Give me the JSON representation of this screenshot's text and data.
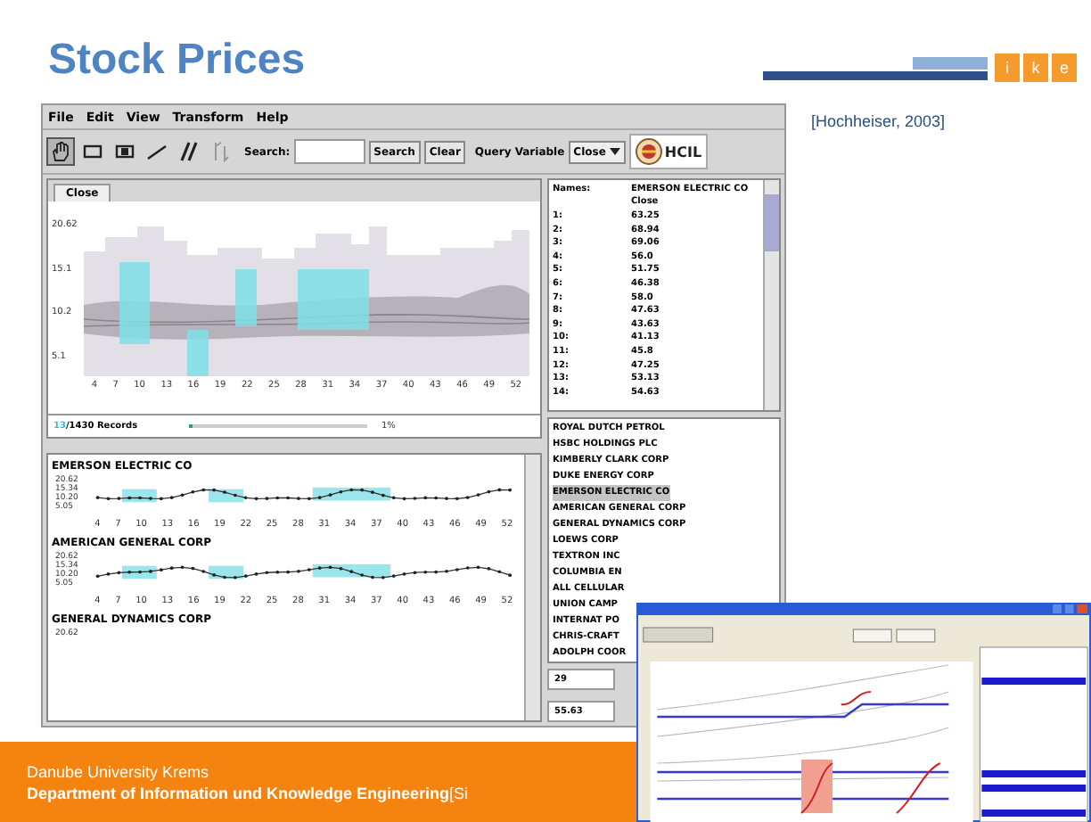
{
  "slide": {
    "title": "Stock Prices",
    "logo_letters": [
      "i",
      "k",
      "e"
    ],
    "citation": "[Hochheiser, 2003]",
    "footer_lines": [
      "Danube University Krems",
      "Department of Information und Knowledge Engineering"
    ],
    "footer_cut": "[Si"
  },
  "app": {
    "menu": [
      "File",
      "Edit",
      "View",
      "Transform",
      "Help"
    ],
    "tools": [
      {
        "kind": "hand",
        "selected": true
      },
      {
        "kind": "rect",
        "selected": false
      },
      {
        "kind": "filled-rect",
        "selected": false
      },
      {
        "kind": "line",
        "selected": false
      },
      {
        "kind": "parallel",
        "selected": false
      },
      {
        "kind": "angle",
        "selected": false
      }
    ],
    "search_label": "Search:",
    "search_buttons": [
      "Search",
      "Clear"
    ],
    "query_label": "Query Variable",
    "query_value": "Close",
    "logo_text": "HCIL",
    "tab": "Close",
    "overview": {
      "y_labels": [
        "20.62",
        "15.1",
        "10.2",
        "5.1"
      ],
      "x_labels": [
        "4",
        "7",
        "10",
        "13",
        "16",
        "19",
        "22",
        "25",
        "28",
        "31",
        "34",
        "37",
        "40",
        "43",
        "46",
        "49",
        "52"
      ]
    },
    "status": {
      "records_count": "13",
      "records_total": "/1430 Records",
      "slider_label": "1%",
      "level": 0.02
    },
    "details": [
      {
        "name": "EMERSON ELECTRIC CO",
        "y_labels": [
          "20.62",
          "15.34",
          "10.20",
          "5.05"
        ],
        "x_labels": [
          "4",
          "7",
          "10",
          "13",
          "16",
          "19",
          "22",
          "25",
          "28",
          "31",
          "34",
          "37",
          "40",
          "43",
          "46",
          "49",
          "52"
        ]
      },
      {
        "name": "AMERICAN GENERAL CORP",
        "y_labels": [
          "20.62",
          "15.34",
          "10.20",
          "5.05"
        ],
        "x_labels": [
          "4",
          "7",
          "10",
          "13",
          "16",
          "19",
          "22",
          "25",
          "28",
          "31",
          "34",
          "37",
          "40",
          "43",
          "46",
          "49",
          "52"
        ]
      },
      {
        "name": "GENERAL DYNAMICS CORP",
        "y_labels": [
          "20.62"
        ]
      }
    ],
    "table": {
      "header": [
        "Names:",
        "EMERSON ELECTRIC CO"
      ],
      "subheader": "Close",
      "rows": [
        {
          "label": "1:",
          "value": "63.25"
        },
        {
          "label": "2:",
          "value": "68.94"
        },
        {
          "label": "3:",
          "value": "69.06"
        },
        {
          "label": "4:",
          "value": "56.0"
        },
        {
          "label": "5:",
          "value": "51.75"
        },
        {
          "label": "6:",
          "value": "46.38"
        },
        {
          "label": "7:",
          "value": "58.0"
        },
        {
          "label": "8:",
          "value": "47.63"
        },
        {
          "label": "9:",
          "value": "43.63"
        },
        {
          "label": "10:",
          "value": "41.13"
        },
        {
          "label": "11:",
          "value": "45.8"
        },
        {
          "label": "12:",
          "value": "47.25"
        },
        {
          "label": "13:",
          "value": "53.13"
        },
        {
          "label": "14:",
          "value": "54.63"
        }
      ]
    },
    "names": [
      {
        "name": "ROYAL DUTCH PETROL",
        "selected": false
      },
      {
        "name": "HSBC HOLDINGS PLC",
        "selected": false
      },
      {
        "name": "KIMBERLY CLARK CORP",
        "selected": false
      },
      {
        "name": "DUKE ENERGY CORP",
        "selected": false
      },
      {
        "name": "EMERSON ELECTRIC CO",
        "selected": true
      },
      {
        "name": "AMERICAN GENERAL CORP",
        "selected": false
      },
      {
        "name": "GENERAL DYNAMICS CORP",
        "selected": false
      },
      {
        "name": "LOEWS CORP",
        "selected": false
      },
      {
        "name": "TEXTRON INC",
        "selected": false
      },
      {
        "name": "COLUMBIA EN",
        "selected": false
      },
      {
        "name": "ALL CELLULAR",
        "selected": false
      },
      {
        "name": "UNION CAMP",
        "selected": false
      },
      {
        "name": "INTERNAT PO",
        "selected": false
      },
      {
        "name": "CHRIS-CRAFT",
        "selected": false
      },
      {
        "name": "ADOLPH COOR",
        "selected": false
      }
    ],
    "fields": [
      "29",
      "55.63"
    ]
  }
}
